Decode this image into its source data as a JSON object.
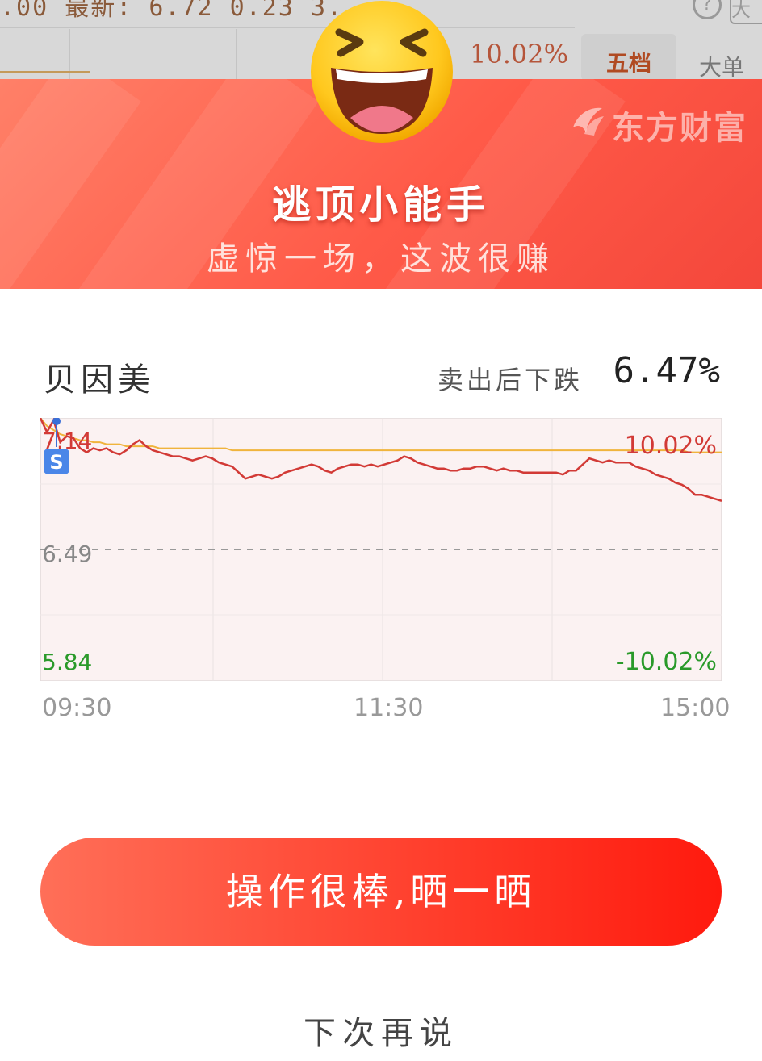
{
  "background": {
    "ticker_text": ".00 最新: 6.72 0.23 3.",
    "pct": "10.02%",
    "tab_five": "五档",
    "tab_big": "大单",
    "help_icon": "question-circle-icon",
    "corner_text": "大"
  },
  "banner": {
    "brand": "东方财富",
    "brand_icon": "eastmoney-logo-icon",
    "emoji_icon": "laughing-face-icon",
    "title": "逃顶小能手",
    "subtitle": "虚惊一场，这波很赚"
  },
  "stock": {
    "name": "贝因美",
    "drop_label": "卖出后下跌",
    "drop_value": "6.47%"
  },
  "chart_data": {
    "type": "line",
    "y_labels": {
      "top": "7.14",
      "mid": "6.49",
      "bottom": "5.84"
    },
    "pct_labels": {
      "top": "10.02%",
      "bottom": "-10.02%"
    },
    "sell_marker": "S",
    "x_ticks": [
      "09:30",
      "11:30",
      "15:00"
    ],
    "ylim": [
      5.84,
      7.14
    ],
    "reference_price": 6.49,
    "colors": {
      "price": "#d23a36",
      "avg": "#f0b43c",
      "up": "#d23a36",
      "down": "#2a9a2a"
    },
    "series": [
      {
        "values": [
          7.14,
          7.07,
          7.13,
          7.02,
          7.05,
          7.04,
          6.99,
          6.97,
          6.99,
          6.98,
          6.99,
          6.97,
          6.96,
          6.98,
          7.01,
          7.03,
          7.0,
          6.98,
          6.97,
          6.96,
          6.95,
          6.95,
          6.94,
          6.93,
          6.94,
          6.95,
          6.94,
          6.92,
          6.91,
          6.9,
          6.87,
          6.84,
          6.85,
          6.86,
          6.85,
          6.84,
          6.85,
          6.87,
          6.88,
          6.89,
          6.9,
          6.91,
          6.9,
          6.88,
          6.87,
          6.89,
          6.9,
          6.91,
          6.91,
          6.9,
          6.91,
          6.9,
          6.91,
          6.92,
          6.93,
          6.95,
          6.94,
          6.92,
          6.91,
          6.9,
          6.89,
          6.89,
          6.88,
          6.88,
          6.89,
          6.89,
          6.9,
          6.9,
          6.89,
          6.88,
          6.89,
          6.88,
          6.88,
          6.87,
          6.87,
          6.87,
          6.87,
          6.87,
          6.87,
          6.86,
          6.88,
          6.88,
          6.91,
          6.94,
          6.93,
          6.92,
          6.93,
          6.92,
          6.92,
          6.92,
          6.9,
          6.89,
          6.88,
          6.86,
          6.85,
          6.84,
          6.82,
          6.81,
          6.79,
          6.76,
          6.76,
          6.75,
          6.74,
          6.73
        ]
      },
      {
        "values": [
          7.14,
          7.1,
          7.08,
          7.06,
          7.05,
          7.04,
          7.03,
          7.03,
          7.02,
          7.02,
          7.01,
          7.01,
          7.01,
          7.0,
          7.0,
          7.0,
          7.0,
          7.0,
          6.99,
          6.99,
          6.99,
          6.99,
          6.99,
          6.99,
          6.99,
          6.99,
          6.99,
          6.99,
          6.99,
          6.98,
          6.98,
          6.98,
          6.98,
          6.98,
          6.98,
          6.98,
          6.98,
          6.98,
          6.98,
          6.98,
          6.98,
          6.98,
          6.98,
          6.98,
          6.98,
          6.98,
          6.98,
          6.98,
          6.98,
          6.98,
          6.98,
          6.98,
          6.98,
          6.98,
          6.98,
          6.98,
          6.98,
          6.98,
          6.98,
          6.98,
          6.98,
          6.98,
          6.98,
          6.98,
          6.98,
          6.98,
          6.98,
          6.98,
          6.98,
          6.98,
          6.98,
          6.98,
          6.98,
          6.98,
          6.98,
          6.98,
          6.98,
          6.98,
          6.98,
          6.98,
          6.98,
          6.98,
          6.98,
          6.98,
          6.98,
          6.98,
          6.98,
          6.98,
          6.98,
          6.98,
          6.98,
          6.98,
          6.98,
          6.98,
          6.98,
          6.98,
          6.98,
          6.98,
          6.97,
          6.97,
          6.97,
          6.97,
          6.97,
          6.97
        ]
      }
    ]
  },
  "actions": {
    "share_label": "操作很棒,晒一晒",
    "later_label": "下次再说"
  }
}
